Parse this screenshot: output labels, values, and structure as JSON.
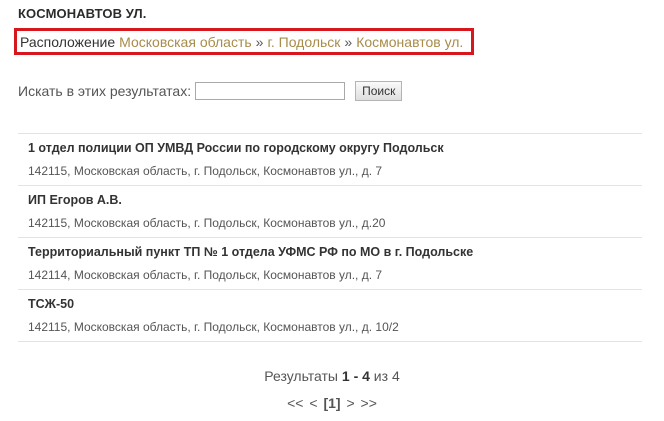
{
  "heading": "КОСМОНАВТОВ УЛ.",
  "breadcrumb": {
    "label": "Расположение",
    "separator": "»",
    "items": [
      "Московская область",
      "г. Подольск",
      "Космонавтов ул."
    ]
  },
  "search": {
    "label": "Искать в этих результатах:",
    "value": "",
    "button": "Поиск"
  },
  "results": [
    {
      "title": "1 отдел полиции ОП УМВД России по городскому округу Подольск",
      "address": "142115, Московская область, г. Подольск, Космонавтов ул., д. 7"
    },
    {
      "title": "ИП Егоров А.В.",
      "address": "142115, Московская область, г. Подольск, Космонавтов ул., д.20"
    },
    {
      "title": "Территориальный пункт ТП № 1 отдела УФМС РФ по МО в г. Подольске",
      "address": "142114, Московская область, г. Подольск, Космонавтов ул., д. 7"
    },
    {
      "title": "ТСЖ-50",
      "address": "142115, Московская область, г. Подольск, Космонавтов ул., д. 10/2"
    }
  ],
  "counter": {
    "prefix": "Результаты",
    "range": "1 - 4",
    "of": "из",
    "total": "4"
  },
  "pagination": {
    "first": "<<",
    "prev": "<",
    "current": "[1]",
    "next": ">",
    "last": ">>"
  },
  "colors": {
    "highlight_border": "#d8161e",
    "link": "#a88c4a"
  }
}
